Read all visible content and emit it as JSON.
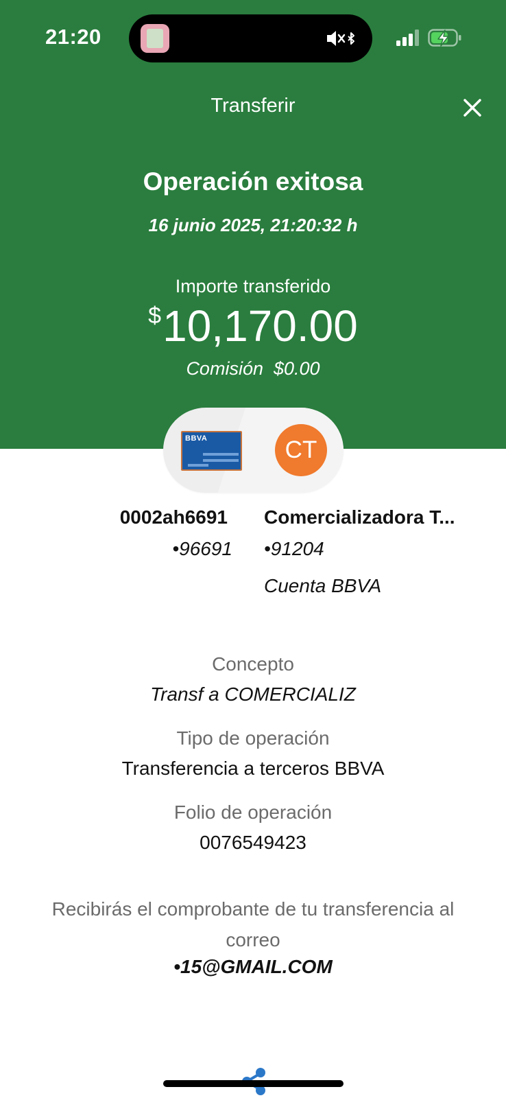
{
  "status_bar": {
    "time": "21:20",
    "icons": [
      "app-thumbnail-icon",
      "speaker-mute-icon",
      "bluetooth-icon",
      "cellular-signal-icon",
      "battery-charging-icon"
    ]
  },
  "nav": {
    "title": "Transferir",
    "close_icon": "close-icon"
  },
  "result": {
    "title": "Operación exitosa",
    "datetime": "16 junio 2025, 21:20:32 h",
    "amount_label": "Importe transferido",
    "currency_symbol": "$",
    "amount": "10,170.00",
    "commission": "Comisión  $0.00"
  },
  "transfer": {
    "from": {
      "card_brand": "BBVA",
      "name": "0002ah6691",
      "number": "•96691"
    },
    "to": {
      "initials": "CT",
      "name": "Comercializadora T...",
      "number": "•91204",
      "bank": "Cuenta BBVA"
    }
  },
  "details": [
    {
      "label": "Concepto",
      "value": "Transf a COMERCIALIZ"
    },
    {
      "label": "Tipo de operación",
      "value": "Transferencia a terceros BBVA"
    },
    {
      "label": "Folio de operación",
      "value": "0076549423"
    }
  ],
  "notice": {
    "text": "Recibirás el comprobante de tu transferencia al correo",
    "email": "•15@GMAIL.COM"
  },
  "footer": {
    "share_icon": "share-icon"
  },
  "colors": {
    "header_green": "#2a7d3e",
    "avatar_orange": "#f07a2d",
    "card_blue": "#1a5aa5",
    "share_blue": "#2b78c9"
  }
}
